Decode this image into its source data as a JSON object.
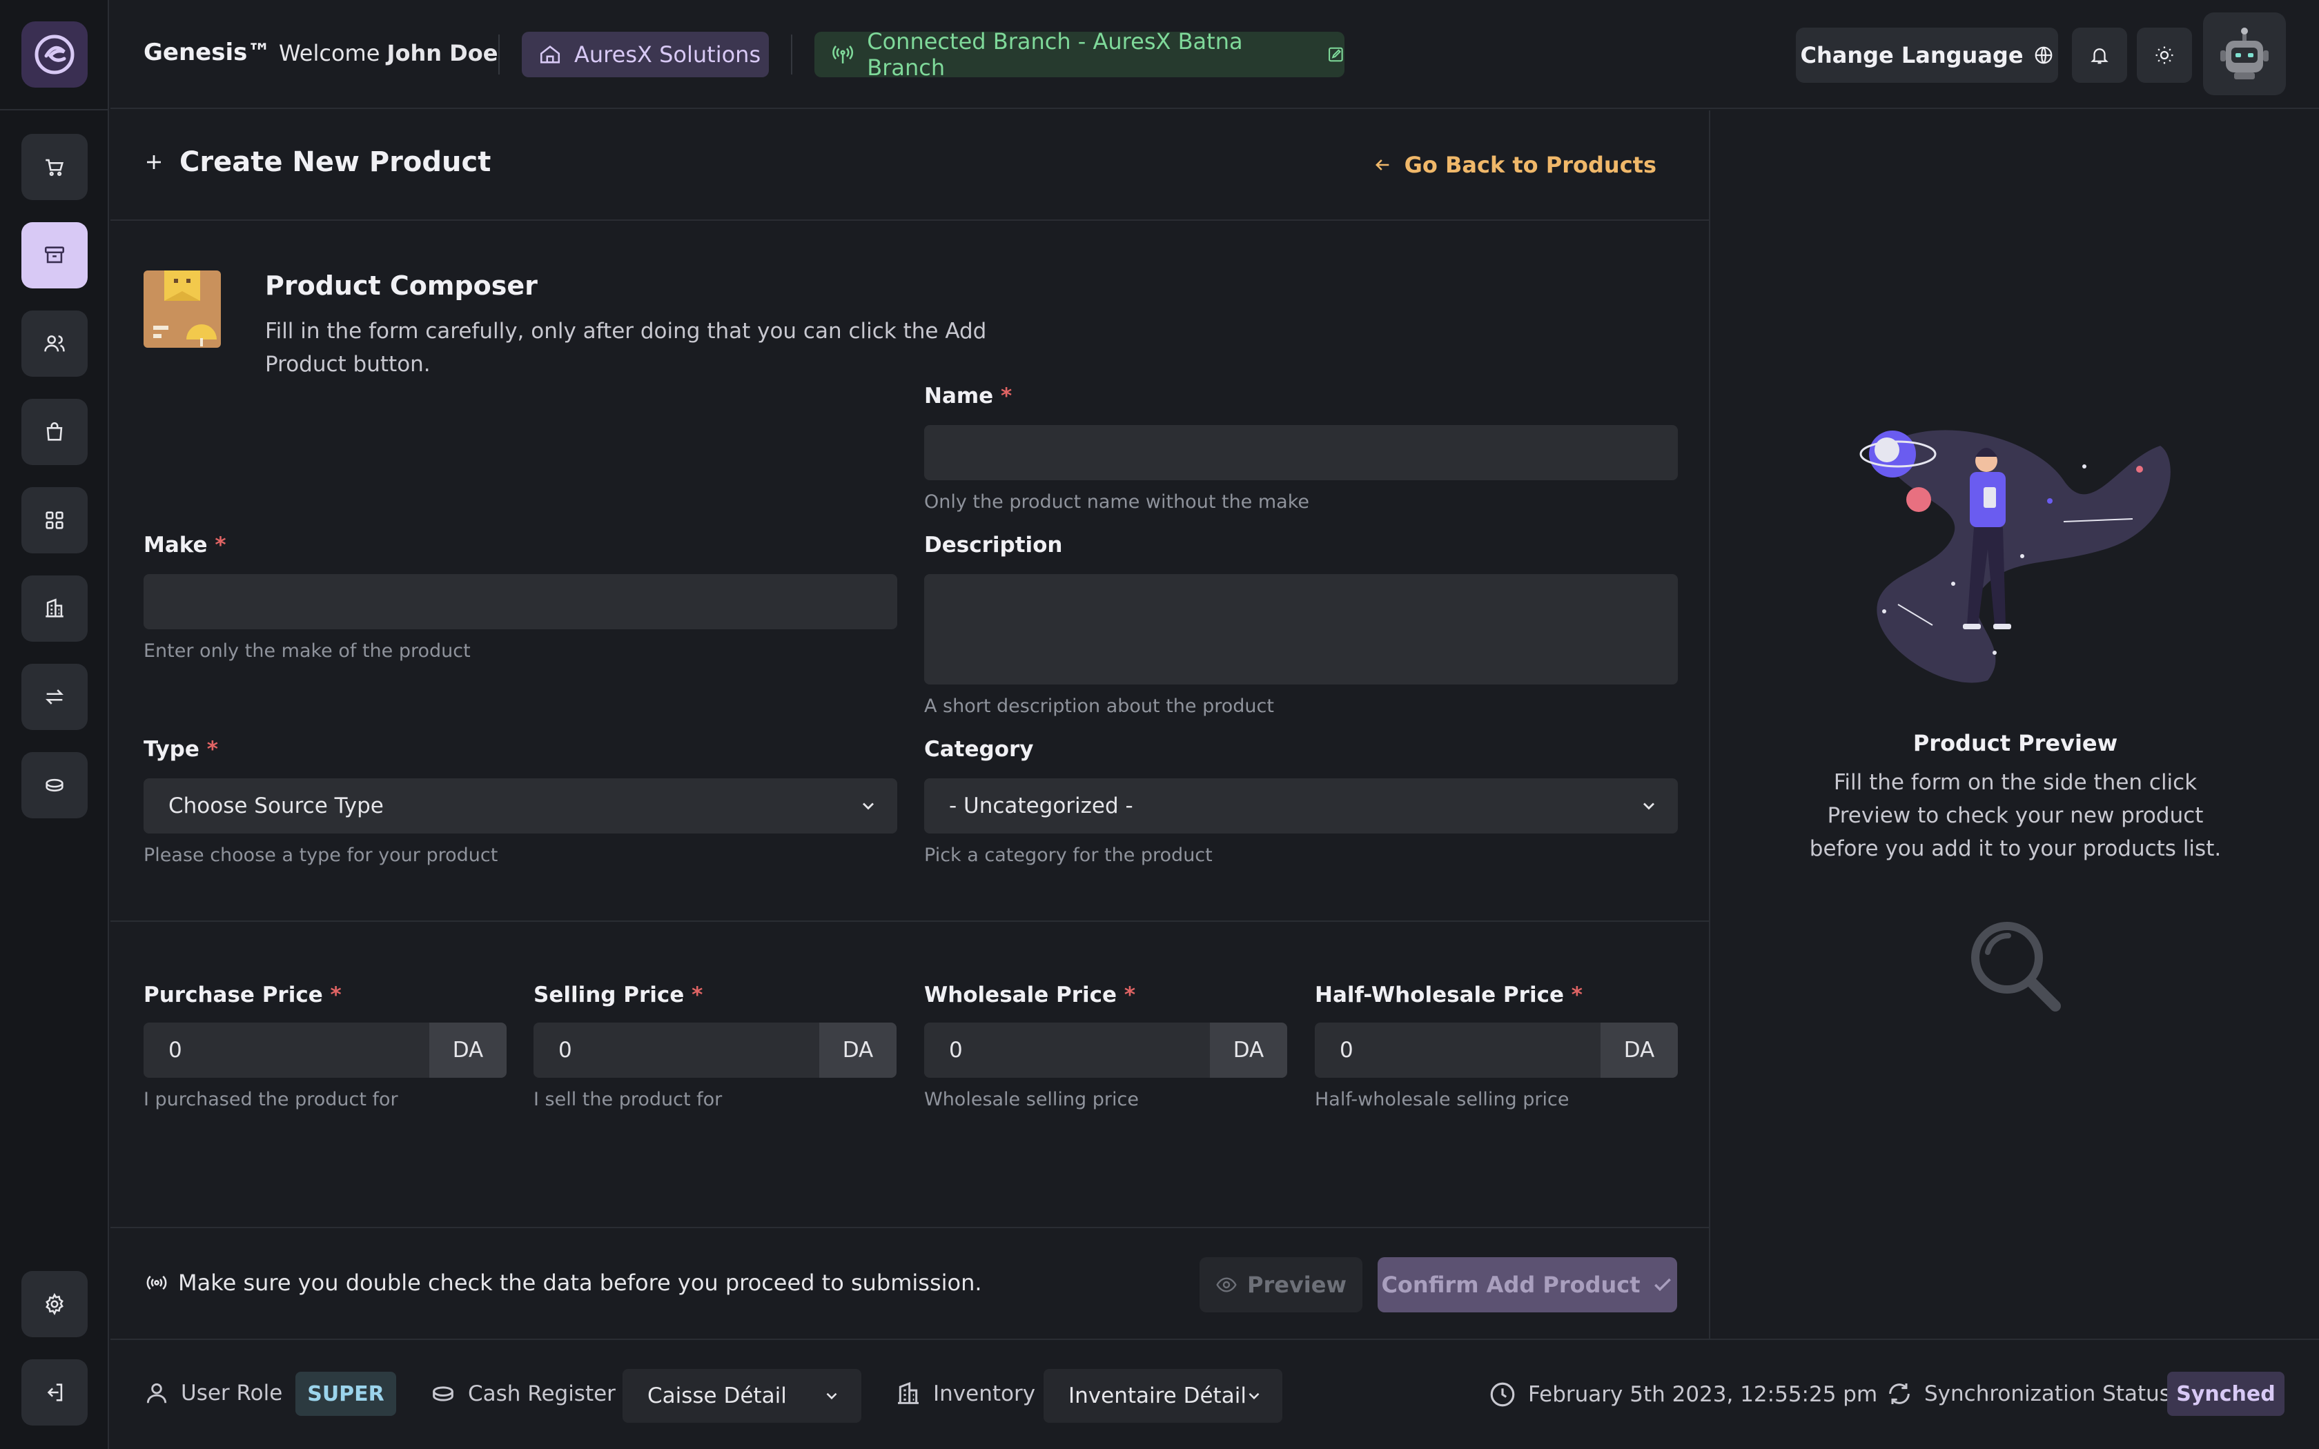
{
  "colors": {
    "accent": "#d8c9f5",
    "link": "#f0b86a",
    "branch_text": "#7fd99a",
    "required": "#e06464"
  },
  "sidebar": {
    "items": [
      {
        "icon": "cart-icon"
      },
      {
        "icon": "archive-box-icon",
        "active": true
      },
      {
        "icon": "users-icon"
      },
      {
        "icon": "shopping-bag-icon"
      },
      {
        "icon": "grid-icon"
      },
      {
        "icon": "building-icon"
      },
      {
        "icon": "transfer-arrows-icon"
      },
      {
        "icon": "coins-icon"
      }
    ],
    "bottom_items": [
      {
        "icon": "gear-icon"
      },
      {
        "icon": "logout-icon"
      }
    ]
  },
  "header": {
    "brand": "Genesis™",
    "welcome_prefix": "Welcome",
    "user_name": "John Doe",
    "company": "AuresX Solutions",
    "branch": "Connected Branch - AuresX Batna Branch",
    "change_language": "Change Language"
  },
  "page": {
    "title": "Create New Product",
    "back_link": "Go Back to Products"
  },
  "composer": {
    "title": "Product Composer",
    "description": "Fill in the form carefully, only after doing that you can click the Add Product button."
  },
  "form": {
    "name": {
      "label": "Name",
      "required_mark": "*",
      "value": "",
      "hint": "Only the product name without the make"
    },
    "make": {
      "label": "Make",
      "required_mark": "*",
      "value": "",
      "hint": "Enter only the make of the product"
    },
    "description": {
      "label": "Description",
      "value": "",
      "hint": "A short description about the product"
    },
    "type": {
      "label": "Type",
      "required_mark": "*",
      "selected": "Choose Source Type",
      "hint": "Please choose a type for your product"
    },
    "category": {
      "label": "Category",
      "selected": "- Uncategorized -",
      "hint": "Pick a category for the product"
    }
  },
  "prices": [
    {
      "label": "Purchase Price",
      "required_mark": "*",
      "value": "0",
      "unit": "DA",
      "hint": "I purchased the product for"
    },
    {
      "label": "Selling Price",
      "required_mark": "*",
      "value": "0",
      "unit": "DA",
      "hint": "I sell the product for"
    },
    {
      "label": "Wholesale Price",
      "required_mark": "*",
      "value": "0",
      "unit": "DA",
      "hint": "Wholesale selling price"
    },
    {
      "label": "Half-Wholesale Price",
      "required_mark": "*",
      "value": "0",
      "unit": "DA",
      "hint": "Half-wholesale selling price"
    }
  ],
  "footer": {
    "note": "Make sure you double check the data before you proceed to submission.",
    "preview_label": "Preview",
    "confirm_label": "Confirm Add Product"
  },
  "preview_panel": {
    "title": "Product Preview",
    "description": "Fill the form on the side then click Preview to check your new product before you add it to your products list."
  },
  "statusbar": {
    "user_role_label": "User Role",
    "user_role": "SUPER",
    "cash_register_label": "Cash Register",
    "cash_register": "Caisse Détail",
    "inventory_label": "Inventory",
    "inventory": "Inventaire Détail",
    "datetime": "February 5th 2023, 12:55:25 pm",
    "sync_label": "Synchronization Status",
    "sync_status": "Synched"
  }
}
